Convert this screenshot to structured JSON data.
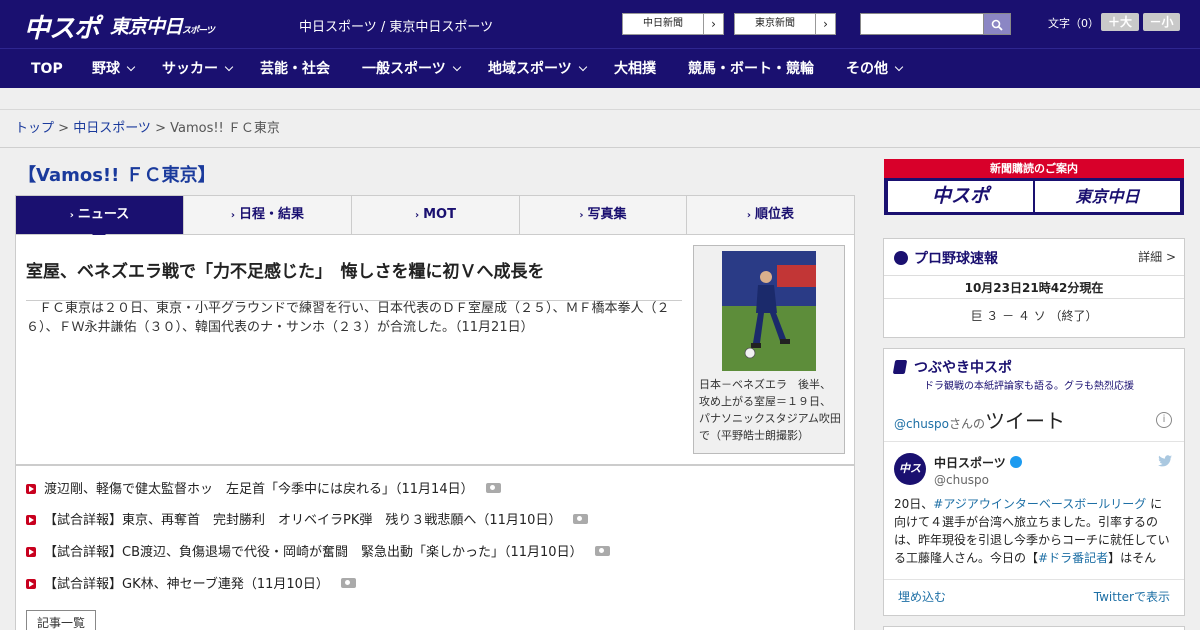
{
  "header": {
    "logo_chuspo": "中スポ",
    "logo_tokyo": "東京中日",
    "logo_tokyo_small": "スポーツ",
    "site_name": "中日スポーツ / 東京中日スポーツ",
    "btn_chunichi": "中日新聞",
    "btn_tokyo": "東京新聞",
    "search_placeholder": "",
    "fontsize_label": "文字（0）",
    "fs_large": "＋大",
    "fs_small": "－小"
  },
  "nav": {
    "items": [
      {
        "label": "TOP"
      },
      {
        "label": "野球"
      },
      {
        "label": "サッカー"
      },
      {
        "label": "芸能・社会"
      },
      {
        "label": "一般スポーツ"
      },
      {
        "label": "地域スポーツ"
      },
      {
        "label": "大相撲"
      },
      {
        "label": "競馬・ボート・競輪"
      },
      {
        "label": "その他"
      }
    ]
  },
  "breadcrumb": {
    "top": "トップ",
    "sep": " > ",
    "section": "中日スポーツ",
    "current": "Vamos!! ＦＣ東京"
  },
  "page": {
    "title": "【Vamos!! ＦＣ東京】"
  },
  "tabs": [
    {
      "label": "ニュース"
    },
    {
      "label": "日程・結果"
    },
    {
      "label": "MOT"
    },
    {
      "label": "写真集"
    },
    {
      "label": "順位表"
    }
  ],
  "tab_marker": "›",
  "article": {
    "headline": "室屋、ベネズエラ戦で「力不足感じた」　悔しさを糧に初Ｖへ成長を",
    "lead": "　ＦＣ東京は２０日、東京・小平グラウンドで練習を行い、日本代表のＤＦ室屋成（２５）、ＭＦ橋本拳人（２６）、ＦＷ永井謙佑（３０）、韓国代表のナ・サンホ（２３）が合流した。（11月21日）",
    "photo_caption": "日本－ベネズエラ　後半、攻め上がる室屋＝１９日、パナソニックスタジアム吹田で（平野皓士朗撮影）"
  },
  "news_list": [
    {
      "text": "渡辺剛、軽傷で健太監督ホッ　左足首「今季中には戻れる」（11月14日）"
    },
    {
      "text": "【試合詳報】東京、再奪首　完封勝利　オリベイラPK弾　残り３戦悲願へ（11月10日）"
    },
    {
      "text": "【試合詳報】CB渡辺、負傷退場で代役・岡崎が奮闘　緊急出動「楽しかった」（11月10日）"
    },
    {
      "text": "【試合詳報】GK林、神セーブ連発（11月10日）"
    }
  ],
  "list_button": "記事一覧",
  "sidebar": {
    "subscribe_head": "新聞購読のご案内",
    "sub_chuspo": "中スポ",
    "sub_tokyo": "東京中日",
    "baseball": {
      "title": "プロ野球速報",
      "more": "詳細 >",
      "time": "10月23日21時42分現在",
      "score": "巨 ３ － ４ ソ （終了）"
    },
    "tweets": {
      "title": "つぶやき中スポ",
      "subtitle": "ドラ観戦の本紙評論家も語る。グラも熱烈応援",
      "head_handle": "@chuspo",
      "head_suffix": "さんの",
      "head_big": "ツイート",
      "info": "i",
      "avatar": "中スポ",
      "name": "中日スポーツ",
      "handle": "@chuspo",
      "text_1": "20日、",
      "text_hashtag": "#アジアウインターベースボールリーグ",
      "text_2": " に向けて４選手が台湾へ旅立ちました。引率するのは、昨年現役を引退し今季からコーチに就任している工藤隆人さん。今日の【",
      "text_hashtag2": "#ドラ番記者",
      "text_3": "】はそんな“新米",
      "embed": "埋め込む",
      "view": "Twitterで表示"
    }
  },
  "colors": {
    "brand_navy": "#1a1070",
    "accent_red": "#d8002a",
    "link_blue": "#1a3a9c"
  }
}
